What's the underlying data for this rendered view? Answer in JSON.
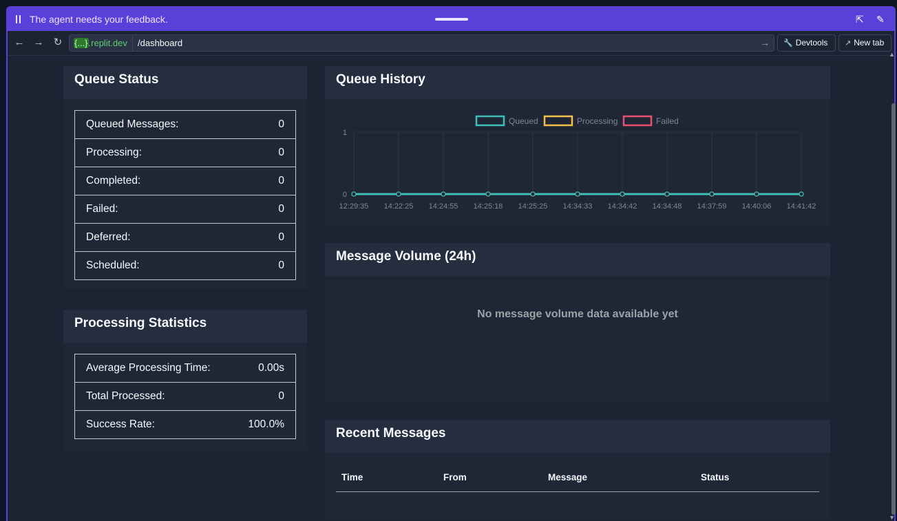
{
  "feedback_bar": {
    "text": "The agent needs your feedback."
  },
  "browser": {
    "host_bracket": "{...}",
    "host_suffix": ".replit.dev",
    "path": "/dashboard",
    "devtools_label": "Devtools",
    "new_tab_label": "New tab"
  },
  "queue_status": {
    "title": "Queue Status",
    "rows": [
      {
        "label": "Queued Messages:",
        "value": "0"
      },
      {
        "label": "Processing:",
        "value": "0"
      },
      {
        "label": "Completed:",
        "value": "0"
      },
      {
        "label": "Failed:",
        "value": "0"
      },
      {
        "label": "Deferred:",
        "value": "0"
      },
      {
        "label": "Scheduled:",
        "value": "0"
      }
    ]
  },
  "processing_statistics": {
    "title": "Processing Statistics",
    "rows": [
      {
        "label": "Average Processing Time:",
        "value": "0.00s"
      },
      {
        "label": "Total Processed:",
        "value": "0"
      },
      {
        "label": "Success Rate:",
        "value": "100.0%"
      }
    ]
  },
  "queue_history": {
    "title": "Queue History",
    "colors": {
      "queued": "#3fbfb7",
      "processing": "#f0c04a",
      "failed": "#e8506e"
    }
  },
  "chart_data": {
    "type": "line",
    "x": [
      "12:29:35",
      "14:22:25",
      "14:24:55",
      "14:25:18",
      "14:25:25",
      "14:34:33",
      "14:34:42",
      "14:34:48",
      "14:37:59",
      "14:40:06",
      "14:41:42"
    ],
    "series": [
      {
        "name": "Queued",
        "values": [
          0,
          0,
          0,
          0,
          0,
          0,
          0,
          0,
          0,
          0,
          0
        ]
      },
      {
        "name": "Processing",
        "values": [
          0,
          0,
          0,
          0,
          0,
          0,
          0,
          0,
          0,
          0,
          0
        ]
      },
      {
        "name": "Failed",
        "values": [
          0,
          0,
          0,
          0,
          0,
          0,
          0,
          0,
          0,
          0,
          0
        ]
      }
    ],
    "ylim": [
      0,
      1
    ],
    "yticks": [
      "1",
      "0"
    ],
    "grid": true,
    "legend": "top"
  },
  "message_volume": {
    "title": "Message Volume (24h)",
    "empty_text": "No message volume data available yet"
  },
  "recent_messages": {
    "title": "Recent Messages",
    "columns": [
      "Time",
      "From",
      "Message",
      "Status"
    ]
  }
}
